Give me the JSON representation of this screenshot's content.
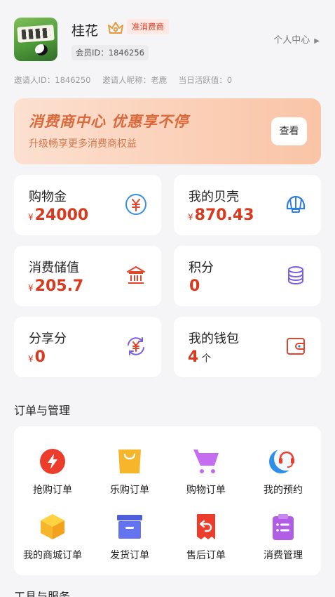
{
  "profile": {
    "name": "桂花",
    "tier_badge": "准消费商",
    "member_id": "会员ID：1846256",
    "center_link": "个人中心"
  },
  "invite": {
    "inviter_id": "邀请人ID：1846250",
    "inviter_nickname": "邀请人昵称：老鹿",
    "active_today": "当日活跃值：0"
  },
  "banner": {
    "title": "消费商中心  优惠享不停",
    "subtitle": "升级畅享更多消费商权益",
    "button": "查看"
  },
  "assets": [
    {
      "label": "购物金",
      "currency": "¥",
      "value": "24000",
      "icon": "yuan-circle-icon"
    },
    {
      "label": "我的贝壳",
      "currency": "¥",
      "value": "870.43",
      "icon": "shell-icon"
    },
    {
      "label": "消费储值",
      "currency": "¥",
      "value": "205.7",
      "icon": "bank-icon"
    },
    {
      "label": "积分",
      "currency": "",
      "value": "0",
      "icon": "coin-stack-icon"
    },
    {
      "label": "分享分",
      "currency": "¥",
      "value": "0",
      "icon": "yuan-exchange-icon"
    },
    {
      "label": "我的钱包",
      "currency": "",
      "value": "4",
      "unit": "个",
      "icon": "wallet-icon"
    }
  ],
  "orders_section": {
    "title": "订单与管理",
    "items": [
      {
        "label": "抢购订单",
        "icon": "lightning-icon"
      },
      {
        "label": "乐购订单",
        "icon": "shopping-bag-icon"
      },
      {
        "label": "购物订单",
        "icon": "cart-icon"
      },
      {
        "label": "我的预约",
        "icon": "headset-icon"
      },
      {
        "label": "我的商城订单",
        "icon": "box-icon"
      },
      {
        "label": "发货订单",
        "icon": "archive-box-icon"
      },
      {
        "label": "售后订单",
        "icon": "return-icon"
      },
      {
        "label": "消费管理",
        "icon": "clipboard-icon"
      }
    ]
  },
  "next_section": {
    "title": "工具与服务"
  },
  "colors": {
    "accent_red": "#d9391e",
    "banner_orange": "#d96a3c",
    "background": "#f5f5f7"
  }
}
